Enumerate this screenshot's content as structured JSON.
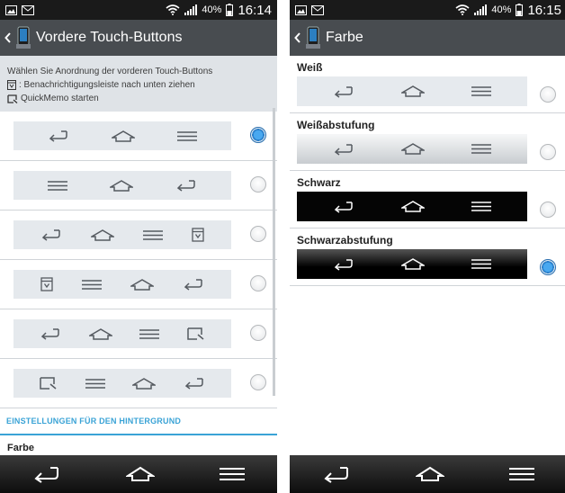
{
  "left": {
    "status": {
      "battery": "40%",
      "time": "16:14"
    },
    "title": "Vordere Touch-Buttons",
    "description": {
      "line1": "Wählen Sie Anordnung der vorderen Touch-Buttons",
      "line2": ": Benachrichtigungsleiste nach unten ziehen",
      "line3": "QuickMemo starten"
    },
    "options": [
      {
        "buttons": [
          "back-icon",
          "home-icon",
          "menu-icon"
        ],
        "selected": true
      },
      {
        "buttons": [
          "menu-icon",
          "home-icon",
          "back-icon"
        ],
        "selected": false
      },
      {
        "buttons": [
          "back-icon",
          "home-icon",
          "menu-icon",
          "notification-icon"
        ],
        "selected": false
      },
      {
        "buttons": [
          "notification-icon",
          "menu-icon",
          "home-icon",
          "back-icon"
        ],
        "selected": false
      },
      {
        "buttons": [
          "back-icon",
          "home-icon",
          "menu-icon",
          "quickmemo-icon"
        ],
        "selected": false
      },
      {
        "buttons": [
          "quickmemo-icon",
          "menu-icon",
          "home-icon",
          "back-icon"
        ],
        "selected": false
      }
    ],
    "section_header": "EINSTELLUNGEN FÜR DEN HINTERGRUND",
    "partial_item": "Farbe"
  },
  "right": {
    "status": {
      "battery": "40%",
      "time": "16:15"
    },
    "title": "Farbe",
    "options": [
      {
        "label": "Weiß",
        "style": "weiss",
        "selected": false
      },
      {
        "label": "Weißabstufung",
        "style": "weissgrad",
        "selected": false
      },
      {
        "label": "Schwarz",
        "style": "schwarz",
        "selected": false
      },
      {
        "label": "Schwarzabstufung",
        "style": "schwarzgrad",
        "selected": true
      }
    ]
  },
  "colors": {
    "accent": "#3aa3d6",
    "actionbar": "#484c50",
    "description_bg": "#dfe3e7"
  }
}
